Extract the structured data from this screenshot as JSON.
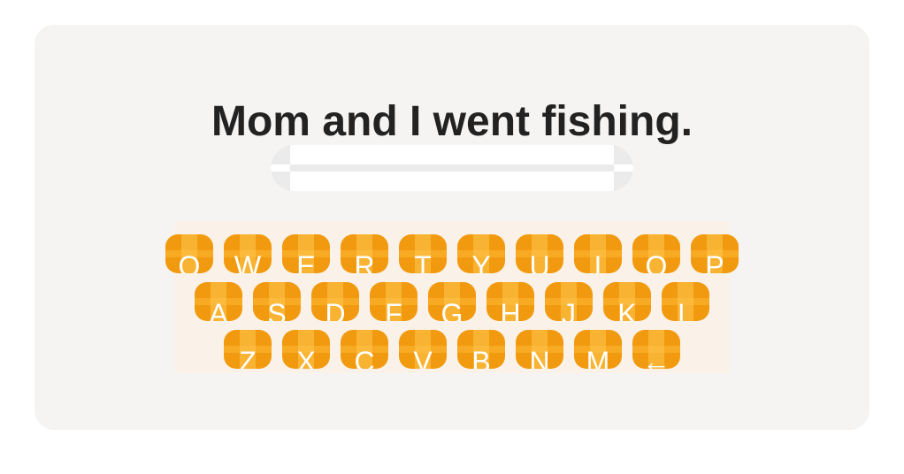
{
  "prompt": {
    "sentence": "Mom and I went fishing."
  },
  "answer": {
    "value": ""
  },
  "keyboard": {
    "row1": [
      "Q",
      "W",
      "E",
      "R",
      "T",
      "Y",
      "U",
      "I",
      "O",
      "P"
    ],
    "row2": [
      "A",
      "S",
      "D",
      "F",
      "G",
      "H",
      "J",
      "K",
      "L"
    ],
    "row3": [
      "Z",
      "X",
      "C",
      "V",
      "B",
      "N",
      "M",
      "←"
    ],
    "key_color": "#f29a0f",
    "backspace_icon": "backspace-arrow-icon"
  },
  "colors": {
    "card_background": "#f6f4f2",
    "text": "#222222",
    "answer_box": "#ebebeb"
  }
}
